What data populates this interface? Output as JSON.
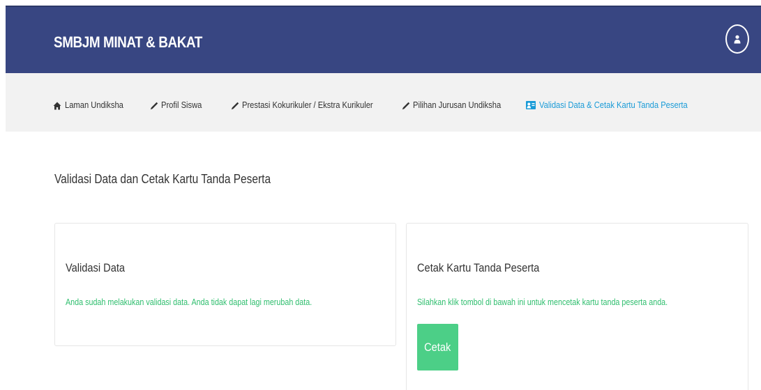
{
  "header": {
    "brand": "SMBJM MINAT & BAKAT",
    "user_icon": "user-circle-icon",
    "bg_color": "#384682"
  },
  "nav": {
    "items": [
      {
        "label": "Laman Undiksha",
        "icon": "home-icon"
      },
      {
        "label": "Profil Siswa",
        "icon": "pencil-icon"
      },
      {
        "label": "Prestasi Kokurikuler / Ekstra Kurikuler",
        "icon": "pencil-icon"
      },
      {
        "label": "Pilihan Jurusan Undiksha",
        "icon": "pencil-icon"
      },
      {
        "label": "Validasi Data & Cetak Kartu Tanda Peserta",
        "icon": "id-card-icon",
        "active": true
      }
    ],
    "active_color": "#1a9bd7"
  },
  "main": {
    "title": "Validasi Data dan Cetak Kartu Tanda Peserta",
    "validasi_card": {
      "title": "Validasi Data",
      "message": "Anda sudah melakukan validasi data. Anda tidak dapat lagi merubah data."
    },
    "cetak_card": {
      "title": "Cetak Kartu Tanda Peserta",
      "message": "Silahkan klik tombol di bawah ini untuk mencetak kartu tanda peserta anda.",
      "button_label": "Cetak",
      "button_color": "#4ccf87"
    },
    "message_color": "#2fbe6e"
  }
}
